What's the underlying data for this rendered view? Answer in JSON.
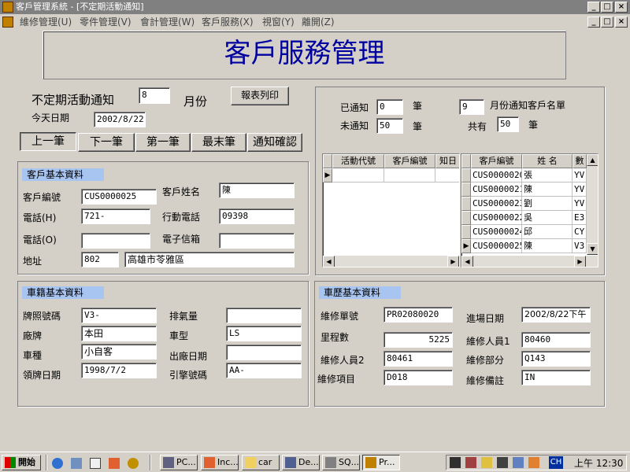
{
  "window": {
    "title": "客戶管理系統 - [不定期活動通知]"
  },
  "menu": [
    "維修管理(U)",
    "零件管理(V)",
    "會計管理(W)",
    "客戶服務(X)",
    "視窗(Y)",
    "離開(Z)"
  ],
  "header": {
    "title": "客戶服務管理"
  },
  "notice": {
    "label": "不定期活動通知",
    "month_value": "8",
    "month_unit": "月份",
    "print_button": "報表列印",
    "today_label": "今天日期",
    "today_value": "2002/8/22"
  },
  "nav_buttons": [
    "上一筆",
    "下一筆",
    "第一筆",
    "最末筆",
    "通知確認"
  ],
  "stats": {
    "notified_label": "已通知",
    "notified_value": "0",
    "unit": "筆",
    "not_notified_label": "未通知",
    "not_notified_value": "50",
    "list_month_value": "9",
    "list_label": "月份通知客戶名單",
    "total_label": "共有",
    "total_value": "50"
  },
  "activity_grid": {
    "columns": [
      "活動代號",
      "客戶編號",
      "知日"
    ]
  },
  "customer_grid": {
    "columns": [
      "客戶編號",
      "姓 名",
      "數"
    ],
    "rows": [
      [
        "CUS0000020",
        "張",
        "YV"
      ],
      [
        "CUS0000021",
        "陳",
        "YV"
      ],
      [
        "CUS0000023",
        "劉",
        "YV"
      ],
      [
        "CUS0000022",
        "吳",
        "E3"
      ],
      [
        "CUS0000024",
        "邱",
        "CY"
      ],
      [
        "CUS0000025",
        "陳",
        "V3"
      ]
    ]
  },
  "customer": {
    "section_title": "客戶基本資料",
    "id_label": "客戶編號",
    "id_value": "CUS0000025",
    "name_label": "客戶姓名",
    "name_value": "陳",
    "phone_h_label": "電話(H)",
    "phone_h_value": "721-",
    "mobile_label": "行動電話",
    "mobile_value": "09398",
    "phone_o_label": "電話(O)",
    "phone_o_value": "",
    "email_label": "電子信箱",
    "email_value": "",
    "address_label": "地址",
    "zip_value": "802",
    "address_value": "高雄市苓雅區"
  },
  "vehicle": {
    "section_title": "車籍基本資料",
    "plate_label": "牌照號碼",
    "plate_value": "V3-",
    "displacement_label": "排氣量",
    "displacement_value": "",
    "brand_label": "廠牌",
    "brand_value": "本田",
    "model_label": "車型",
    "model_value": "LS",
    "type_label": "車種",
    "type_value": "小自客",
    "mfg_date_label": "出廠日期",
    "mfg_date_value": "",
    "license_date_label": "領牌日期",
    "license_date_value": "1998/7/2",
    "engine_label": "引擎號碼",
    "engine_value": "AA-"
  },
  "history": {
    "section_title": "車歷基本資料",
    "repair_no_label": "維修單號",
    "repair_no_value": "PR02080020",
    "entry_date_label": "進場日期",
    "entry_date_value": "2002/8/22下午",
    "mileage_label": "里程數",
    "mileage_value": "5225",
    "tech1_label": "維修人員1",
    "tech1_value": "80460",
    "tech2_label": "維修人員2",
    "tech2_value": "80461",
    "dept_label": "維修部分",
    "dept_value": "Q143",
    "item_label": "維修項目",
    "item_value": "D018",
    "note_label": "維修備註",
    "note_value": "IN"
  },
  "taskbar": {
    "start": "開始",
    "tasks": [
      "PC...",
      "Inc...",
      "car",
      "De...",
      "SQ...",
      "Pr..."
    ],
    "clock": "上午 12:30",
    "ime": "CH"
  },
  "colors": {
    "section_title_bg": "#a8c4f0",
    "title_color": "#0000a0",
    "taskbar_bg": "#d4d0c8"
  }
}
